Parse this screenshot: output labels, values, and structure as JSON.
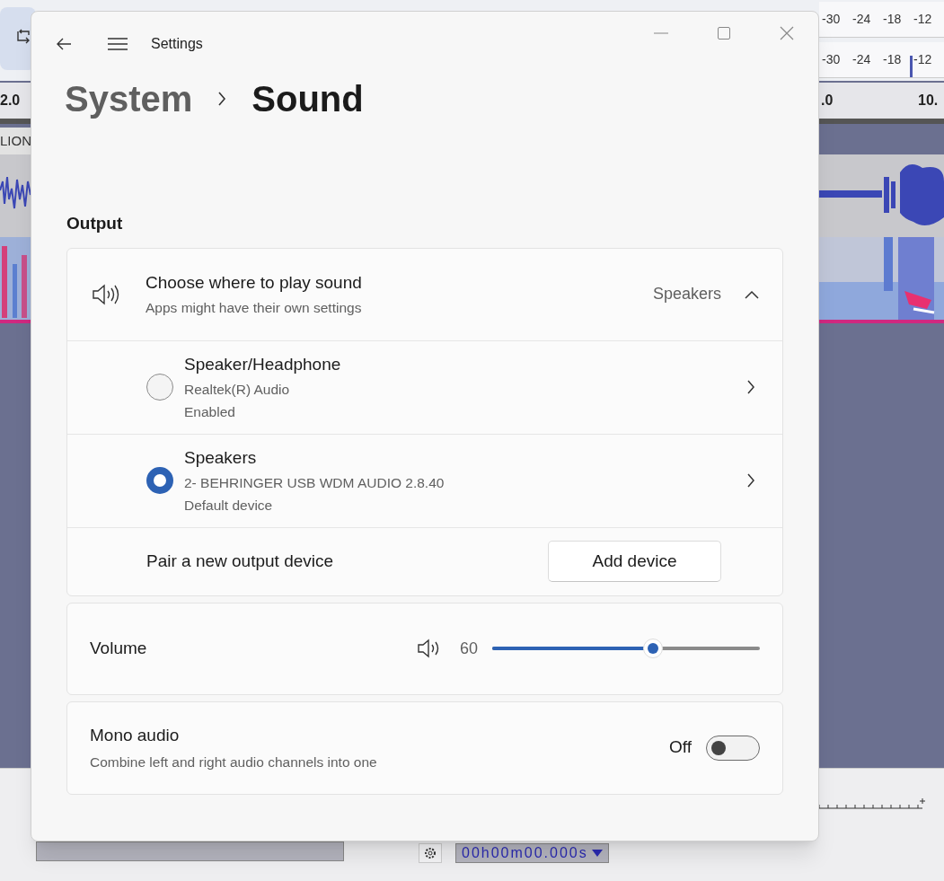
{
  "background_app": {
    "meter_scales": [
      [
        "-30",
        "-24",
        "-18",
        "-12"
      ],
      [
        "-30",
        "-24",
        "-18",
        "-12"
      ]
    ],
    "ruler_labels": [
      "2.0",
      ".0",
      "10."
    ],
    "track_name": "LION",
    "selection_time": "00h00m00.000s"
  },
  "window": {
    "title": "Settings"
  },
  "breadcrumb": [
    "System",
    "Sound"
  ],
  "section_title": "Output",
  "output_card": {
    "title": "Choose where to play sound",
    "subtitle": "Apps might have their own settings",
    "value": "Speakers",
    "expanded": true,
    "devices": [
      {
        "name": "Speaker/Headphone",
        "driver": "Realtek(R) Audio",
        "status": "Enabled",
        "selected": false
      },
      {
        "name": "Speakers",
        "driver": "2- BEHRINGER USB WDM AUDIO 2.8.40",
        "status": "Default device",
        "selected": true
      }
    ],
    "pair": {
      "label": "Pair a new output device",
      "button": "Add device"
    }
  },
  "volume": {
    "label": "Volume",
    "reading": "60",
    "level": 0.6
  },
  "mono_audio": {
    "title": "Mono audio",
    "subtitle": "Combine left and right audio channels into one",
    "state_label": "Off",
    "on": false
  }
}
